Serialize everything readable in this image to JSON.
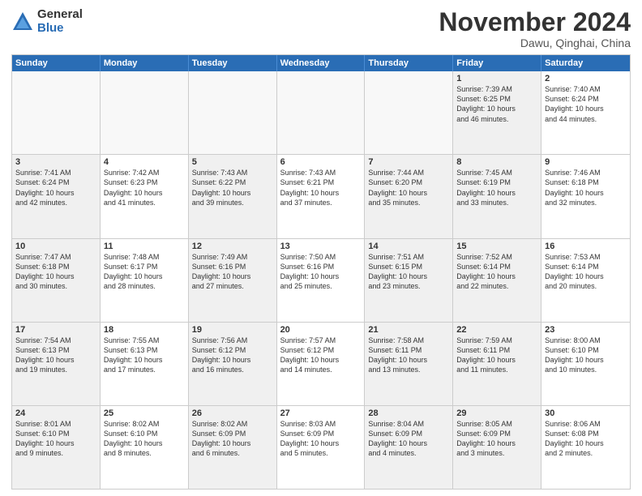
{
  "header": {
    "logo": {
      "general": "General",
      "blue": "Blue"
    },
    "title": "November 2024",
    "location": "Dawu, Qinghai, China"
  },
  "calendar": {
    "weekdays": [
      "Sunday",
      "Monday",
      "Tuesday",
      "Wednesday",
      "Thursday",
      "Friday",
      "Saturday"
    ],
    "rows": [
      {
        "cells": [
          {
            "day": null,
            "empty": true
          },
          {
            "day": null,
            "empty": true
          },
          {
            "day": null,
            "empty": true
          },
          {
            "day": null,
            "empty": true
          },
          {
            "day": null,
            "empty": true
          },
          {
            "day": "1",
            "info": "Sunrise: 7:39 AM\nSunset: 6:25 PM\nDaylight: 10 hours\nand 46 minutes.",
            "shaded": true
          },
          {
            "day": "2",
            "info": "Sunrise: 7:40 AM\nSunset: 6:24 PM\nDaylight: 10 hours\nand 44 minutes.",
            "shaded": false
          }
        ]
      },
      {
        "cells": [
          {
            "day": "3",
            "info": "Sunrise: 7:41 AM\nSunset: 6:24 PM\nDaylight: 10 hours\nand 42 minutes.",
            "shaded": true
          },
          {
            "day": "4",
            "info": "Sunrise: 7:42 AM\nSunset: 6:23 PM\nDaylight: 10 hours\nand 41 minutes.",
            "shaded": false
          },
          {
            "day": "5",
            "info": "Sunrise: 7:43 AM\nSunset: 6:22 PM\nDaylight: 10 hours\nand 39 minutes.",
            "shaded": true
          },
          {
            "day": "6",
            "info": "Sunrise: 7:43 AM\nSunset: 6:21 PM\nDaylight: 10 hours\nand 37 minutes.",
            "shaded": false
          },
          {
            "day": "7",
            "info": "Sunrise: 7:44 AM\nSunset: 6:20 PM\nDaylight: 10 hours\nand 35 minutes.",
            "shaded": true
          },
          {
            "day": "8",
            "info": "Sunrise: 7:45 AM\nSunset: 6:19 PM\nDaylight: 10 hours\nand 33 minutes.",
            "shaded": true
          },
          {
            "day": "9",
            "info": "Sunrise: 7:46 AM\nSunset: 6:18 PM\nDaylight: 10 hours\nand 32 minutes.",
            "shaded": false
          }
        ]
      },
      {
        "cells": [
          {
            "day": "10",
            "info": "Sunrise: 7:47 AM\nSunset: 6:18 PM\nDaylight: 10 hours\nand 30 minutes.",
            "shaded": true
          },
          {
            "day": "11",
            "info": "Sunrise: 7:48 AM\nSunset: 6:17 PM\nDaylight: 10 hours\nand 28 minutes.",
            "shaded": false
          },
          {
            "day": "12",
            "info": "Sunrise: 7:49 AM\nSunset: 6:16 PM\nDaylight: 10 hours\nand 27 minutes.",
            "shaded": true
          },
          {
            "day": "13",
            "info": "Sunrise: 7:50 AM\nSunset: 6:16 PM\nDaylight: 10 hours\nand 25 minutes.",
            "shaded": false
          },
          {
            "day": "14",
            "info": "Sunrise: 7:51 AM\nSunset: 6:15 PM\nDaylight: 10 hours\nand 23 minutes.",
            "shaded": true
          },
          {
            "day": "15",
            "info": "Sunrise: 7:52 AM\nSunset: 6:14 PM\nDaylight: 10 hours\nand 22 minutes.",
            "shaded": true
          },
          {
            "day": "16",
            "info": "Sunrise: 7:53 AM\nSunset: 6:14 PM\nDaylight: 10 hours\nand 20 minutes.",
            "shaded": false
          }
        ]
      },
      {
        "cells": [
          {
            "day": "17",
            "info": "Sunrise: 7:54 AM\nSunset: 6:13 PM\nDaylight: 10 hours\nand 19 minutes.",
            "shaded": true
          },
          {
            "day": "18",
            "info": "Sunrise: 7:55 AM\nSunset: 6:13 PM\nDaylight: 10 hours\nand 17 minutes.",
            "shaded": false
          },
          {
            "day": "19",
            "info": "Sunrise: 7:56 AM\nSunset: 6:12 PM\nDaylight: 10 hours\nand 16 minutes.",
            "shaded": true
          },
          {
            "day": "20",
            "info": "Sunrise: 7:57 AM\nSunset: 6:12 PM\nDaylight: 10 hours\nand 14 minutes.",
            "shaded": false
          },
          {
            "day": "21",
            "info": "Sunrise: 7:58 AM\nSunset: 6:11 PM\nDaylight: 10 hours\nand 13 minutes.",
            "shaded": true
          },
          {
            "day": "22",
            "info": "Sunrise: 7:59 AM\nSunset: 6:11 PM\nDaylight: 10 hours\nand 11 minutes.",
            "shaded": true
          },
          {
            "day": "23",
            "info": "Sunrise: 8:00 AM\nSunset: 6:10 PM\nDaylight: 10 hours\nand 10 minutes.",
            "shaded": false
          }
        ]
      },
      {
        "cells": [
          {
            "day": "24",
            "info": "Sunrise: 8:01 AM\nSunset: 6:10 PM\nDaylight: 10 hours\nand 9 minutes.",
            "shaded": true
          },
          {
            "day": "25",
            "info": "Sunrise: 8:02 AM\nSunset: 6:10 PM\nDaylight: 10 hours\nand 8 minutes.",
            "shaded": false
          },
          {
            "day": "26",
            "info": "Sunrise: 8:02 AM\nSunset: 6:09 PM\nDaylight: 10 hours\nand 6 minutes.",
            "shaded": true
          },
          {
            "day": "27",
            "info": "Sunrise: 8:03 AM\nSunset: 6:09 PM\nDaylight: 10 hours\nand 5 minutes.",
            "shaded": false
          },
          {
            "day": "28",
            "info": "Sunrise: 8:04 AM\nSunset: 6:09 PM\nDaylight: 10 hours\nand 4 minutes.",
            "shaded": true
          },
          {
            "day": "29",
            "info": "Sunrise: 8:05 AM\nSunset: 6:09 PM\nDaylight: 10 hours\nand 3 minutes.",
            "shaded": true
          },
          {
            "day": "30",
            "info": "Sunrise: 8:06 AM\nSunset: 6:08 PM\nDaylight: 10 hours\nand 2 minutes.",
            "shaded": false
          }
        ]
      }
    ]
  }
}
